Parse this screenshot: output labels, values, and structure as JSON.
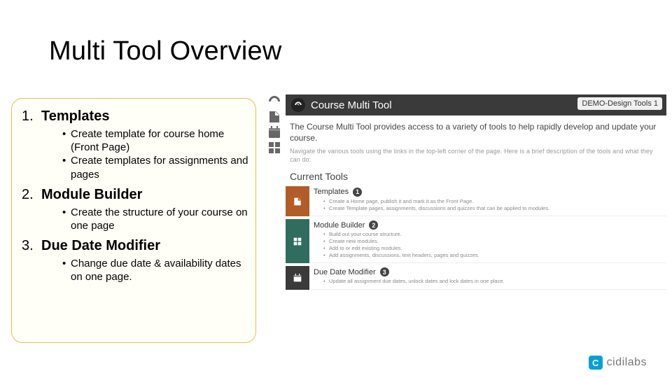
{
  "title": "Multi Tool Overview",
  "left": {
    "items": [
      {
        "num": "1.",
        "head": "Templates",
        "bullets": [
          "Create template for course home (Front Page)",
          "Create templates for assignments and pages"
        ]
      },
      {
        "num": "2.",
        "head": "Module Builder",
        "bullets": [
          "Create the structure of your course on one page"
        ]
      },
      {
        "num": "3.",
        "head": "Due Date Modifier",
        "bullets": [
          "Change due date & availability dates on one page."
        ]
      }
    ]
  },
  "right": {
    "sideTabs": [
      "dashboard-icon",
      "import-icon",
      "calendar-icon",
      "grid-icon"
    ],
    "bar": {
      "title": "Course Multi Tool",
      "badge": "DEMO-Design Tools 1"
    },
    "desc": "The Course Multi Tool provides access to a variety of tools to help rapidly develop and update your course.",
    "blurText": "Navigate the various tools using the links in the top-left corner of the page. Here is a brief description of the tools and what they can do:",
    "currentToolsLabel": "Current Tools",
    "panels": [
      {
        "color": "#b25d27",
        "icon": "import-icon",
        "num": "1",
        "name": "Templates",
        "items": [
          "Create a Home page, publish it and mark it as the Front Page.",
          "Create Template pages, assignments, discussions and quizzes that can be applied to modules."
        ]
      },
      {
        "color": "#2f6e5e",
        "icon": "grid-icon",
        "num": "2",
        "name": "Module Builder",
        "items": [
          "Build out your course structure.",
          "Create new modules.",
          "Add to or edit existing modules.",
          "Add assignments, discussions, text headers, pages and quizzes."
        ]
      },
      {
        "color": "#3a3a3a",
        "icon": "calendar-icon",
        "num": "3",
        "name": "Due Date Modifier",
        "items": [
          "Update all assignment due dates, unlock dates and lock dates in one place."
        ]
      }
    ]
  },
  "footer": {
    "logoLetter": "C",
    "brand": "cidilabs"
  }
}
